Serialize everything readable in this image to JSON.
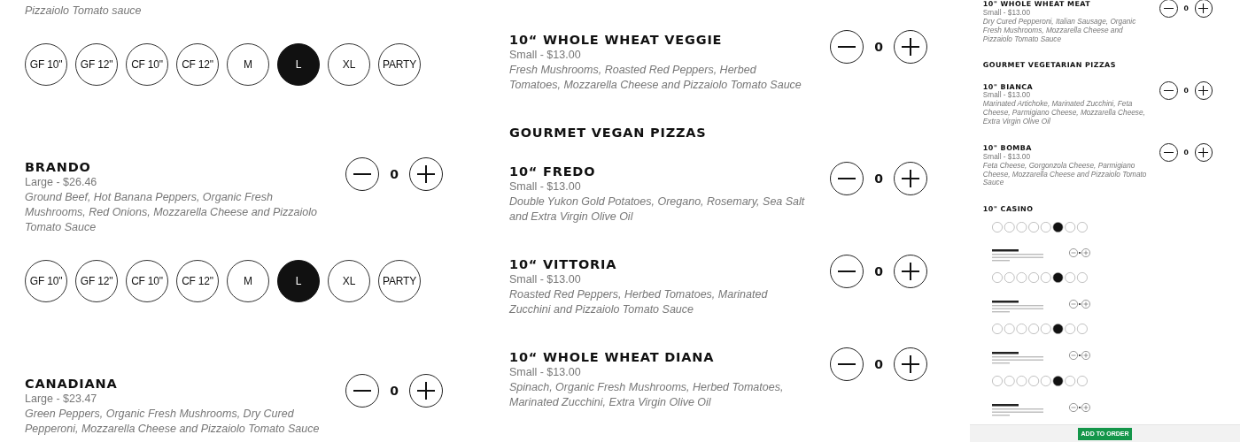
{
  "columns": [
    {
      "entries": [
        {
          "kind": "item",
          "description": "Pizzaiolo Tomato sauce",
          "sizes": [
            {
              "label": "GF 10\"",
              "selected": false
            },
            {
              "label": "GF 12\"",
              "selected": false
            },
            {
              "label": "CF 10\"",
              "selected": false
            },
            {
              "label": "CF 12\"",
              "selected": false
            },
            {
              "label": "M",
              "selected": false
            },
            {
              "label": "L",
              "selected": true
            },
            {
              "label": "XL",
              "selected": false
            },
            {
              "label": "PARTY",
              "selected": false
            }
          ]
        },
        {
          "kind": "item",
          "name": "BRANDO",
          "size_price": "Large - $26.46",
          "description": "Ground Beef, Hot Banana Peppers, Organic Fresh Mushrooms, Red Onions, Mozzarella Cheese and Pizzaiolo Tomato Sauce",
          "quantity": "0",
          "sizes": [
            {
              "label": "GF 10\"",
              "selected": false
            },
            {
              "label": "GF 12\"",
              "selected": false
            },
            {
              "label": "CF 10\"",
              "selected": false
            },
            {
              "label": "CF 12\"",
              "selected": false
            },
            {
              "label": "M",
              "selected": false
            },
            {
              "label": "L",
              "selected": true
            },
            {
              "label": "XL",
              "selected": false
            },
            {
              "label": "PARTY",
              "selected": false
            }
          ]
        },
        {
          "kind": "item",
          "name": "CANADIANA",
          "size_price": "Large - $23.47",
          "description": "Green Peppers, Organic Fresh Mushrooms, Dry Cured Pepperoni, Mozzarella Cheese and Pizzaiolo Tomato Sauce",
          "quantity": "0"
        }
      ]
    },
    {
      "entries": [
        {
          "kind": "item",
          "name": "10“ WHOLE WHEAT VEGGIE",
          "size_price": "Small - $13.00",
          "description": "Fresh Mushrooms, Roasted Red Peppers, Herbed Tomatoes, Mozzarella Cheese and Pizzaiolo Tomato Sauce",
          "quantity": "0"
        },
        {
          "kind": "heading",
          "text": "GOURMET VEGAN PIZZAS"
        },
        {
          "kind": "item",
          "name": "10“ FREDO",
          "size_price": "Small - $13.00",
          "description": "Double Yukon Gold Potatoes, Oregano, Rosemary, Sea Salt and Extra Virgin Olive Oil",
          "quantity": "0"
        },
        {
          "kind": "item",
          "name": "10“ VITTORIA",
          "size_price": "Small - $13.00",
          "description": "Roasted Red Peppers, Herbed Tomatoes, Marinated Zucchini and Pizzaiolo Tomato Sauce",
          "quantity": "0"
        },
        {
          "kind": "item",
          "name": "10“ WHOLE WHEAT DIANA",
          "size_price": "Small - $13.00",
          "description": "Spinach, Organic Fresh Mushrooms, Herbed Tomatoes, Marinated Zucchini, Extra Virgin Olive Oil",
          "quantity": "0"
        }
      ]
    }
  ],
  "preview": {
    "entries": [
      {
        "kind": "item",
        "name": "10\" WHOLE WHEAT MEAT",
        "size_price": "Small - $13.00",
        "description": "Dry Cured Pepperoni, Italian Sausage, Organic Fresh Mushrooms, Mozzarella Cheese and Pizzaiolo Tomato Sauce",
        "quantity": "0"
      },
      {
        "kind": "heading",
        "text": "GOURMET VEGETARIAN PIZZAS"
      },
      {
        "kind": "item",
        "name": "10\" BIANCA",
        "size_price": "Small - $13.00",
        "description": "Marinated Artichoke, Marinated Zucchini, Feta Cheese, Parmigiano Cheese, Mozzarella Cheese, Extra Virgin Olive Oil",
        "quantity": "0"
      },
      {
        "kind": "item",
        "name": "10\" BOMBA",
        "size_price": "Small - $13.00",
        "description": "Feta Cheese, Gorgonzola Cheese, Parmigiano Cheese, Mozzarella Cheese and Pizzaiolo Tomato Sauce",
        "quantity": "0"
      },
      {
        "kind": "item",
        "name": "10\" CASINO"
      }
    ]
  },
  "thumbnail": {
    "button": "ADD TO ORDER"
  }
}
